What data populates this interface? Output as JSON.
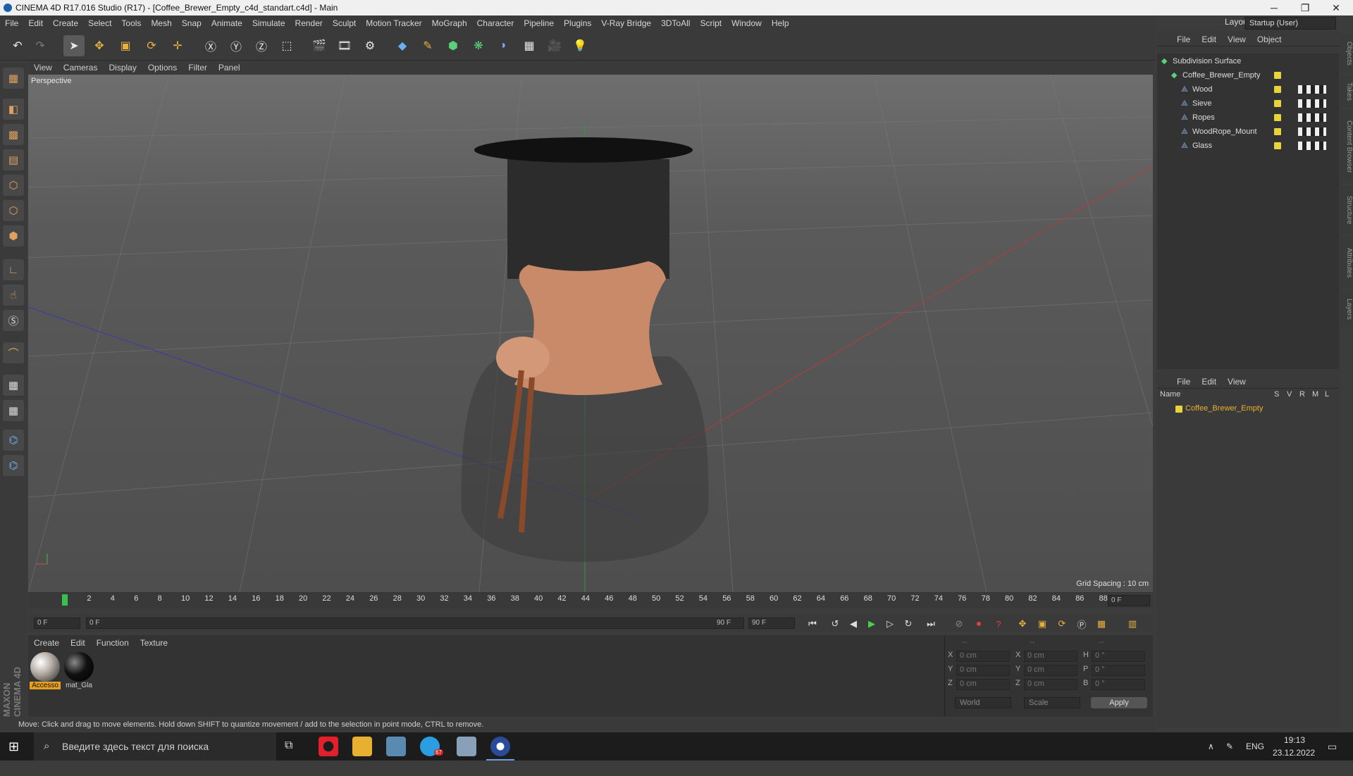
{
  "window": {
    "title": "CINEMA 4D R17.016 Studio (R17) - [Coffee_Brewer_Empty_c4d_standart.c4d] - Main",
    "minimize": "─",
    "maximize": "❐",
    "close": "✕"
  },
  "menu": [
    "File",
    "Edit",
    "Create",
    "Select",
    "Tools",
    "Mesh",
    "Snap",
    "Animate",
    "Simulate",
    "Render",
    "Sculpt",
    "Motion Tracker",
    "MoGraph",
    "Character",
    "Pipeline",
    "Plugins",
    "V-Ray Bridge",
    "3DToAll",
    "Script",
    "Window",
    "Help"
  ],
  "layout": {
    "label": "Layout:",
    "value": "Startup (User)"
  },
  "viewport": {
    "menu": [
      "View",
      "Cameras",
      "Display",
      "Options",
      "Filter",
      "Panel"
    ],
    "label": "Perspective",
    "grid_spacing": "Grid Spacing : 10 cm"
  },
  "timeline": {
    "ticks": [
      "0",
      "2",
      "4",
      "6",
      "8",
      "10",
      "12",
      "14",
      "16",
      "18",
      "20",
      "22",
      "24",
      "26",
      "28",
      "30",
      "32",
      "34",
      "36",
      "38",
      "40",
      "42",
      "44",
      "46",
      "48",
      "50",
      "52",
      "54",
      "56",
      "58",
      "60",
      "62",
      "64",
      "66",
      "68",
      "70",
      "72",
      "74",
      "76",
      "78",
      "80",
      "82",
      "84",
      "86",
      "88",
      "90"
    ],
    "current_frame": "0 F",
    "start": "0 F",
    "slider_start": "0 F",
    "slider_end": "90 F",
    "end": "90 F"
  },
  "material_panel": {
    "menu": [
      "Create",
      "Edit",
      "Function",
      "Texture"
    ],
    "materials": [
      {
        "name": "Accesso",
        "color": "#b8b0a8"
      },
      {
        "name": "mat_Gla",
        "color": "#111111"
      }
    ]
  },
  "coords": {
    "rows": [
      {
        "a": "X",
        "v1": "0 cm",
        "b": "X",
        "v2": "0 cm",
        "c": "H",
        "v3": "0 °"
      },
      {
        "a": "Y",
        "v1": "0 cm",
        "b": "Y",
        "v2": "0 cm",
        "c": "P",
        "v3": "0 °"
      },
      {
        "a": "Z",
        "v1": "0 cm",
        "b": "Z",
        "v2": "0 cm",
        "c": "B",
        "v3": "0 °"
      }
    ],
    "header": [
      "--",
      "--",
      "--"
    ],
    "world": "World",
    "scale": "Scale",
    "apply": "Apply"
  },
  "object_manager": {
    "menu": [
      "File",
      "Edit",
      "View",
      "Object"
    ],
    "objects": [
      {
        "name": "Subdivision Surface",
        "indent": 0
      },
      {
        "name": "Coffee_Brewer_Empty",
        "indent": 1
      },
      {
        "name": "Wood",
        "indent": 2
      },
      {
        "name": "Sieve",
        "indent": 2
      },
      {
        "name": "Ropes",
        "indent": 2
      },
      {
        "name": "WoodRope_Mount",
        "indent": 2
      },
      {
        "name": "Glass",
        "indent": 2
      }
    ]
  },
  "layer_manager": {
    "menu": [
      "File",
      "Edit",
      "View"
    ],
    "columns": [
      "Name",
      "S",
      "V",
      "R",
      "M",
      "L"
    ],
    "layer": "Coffee_Brewer_Empty"
  },
  "side_tabs": [
    "Objects",
    "Takes",
    "Content Browser",
    "Structure",
    "Attributes",
    "Layers"
  ],
  "status": "Move: Click and drag to move elements. Hold down SHIFT to quantize movement / add to the selection in point mode, CTRL to remove.",
  "branding": "MAXON CINEMA 4D",
  "taskbar": {
    "search": "Введите здесь текст для поиска",
    "lang": "ENG",
    "time": "19:13",
    "date": "23.12.2022",
    "badge": "67"
  }
}
